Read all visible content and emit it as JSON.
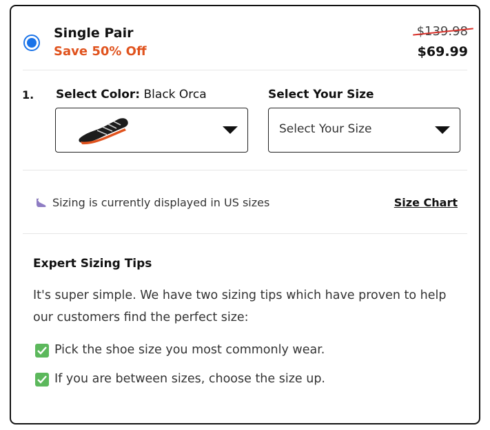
{
  "offer": {
    "title": "Single Pair",
    "discount": "Save 50% Off",
    "old_price": "$139.98",
    "new_price": "$69.99",
    "selected": true,
    "accent_color": "#e0531e",
    "radio_color": "#1a73e8"
  },
  "selection": {
    "step": "1.",
    "color_label": "Select Color:",
    "color_value": "Black Orca",
    "size_label": "Select Your Size",
    "size_placeholder": "Select Your Size",
    "shoe_icon": "shoe-thumbnail-icon"
  },
  "sizing_note": {
    "icon": "shoe-icon",
    "text": "Sizing is currently displayed in US sizes",
    "link": "Size Chart"
  },
  "tips": {
    "title": "Expert Sizing Tips",
    "body": "It's super simple. We have two sizing tips which have proven to help our customers find the perfect size:",
    "items": [
      "Pick the shoe size you most commonly wear.",
      "If you are between sizes, choose the size up."
    ],
    "check_color": "#5cb85c"
  }
}
